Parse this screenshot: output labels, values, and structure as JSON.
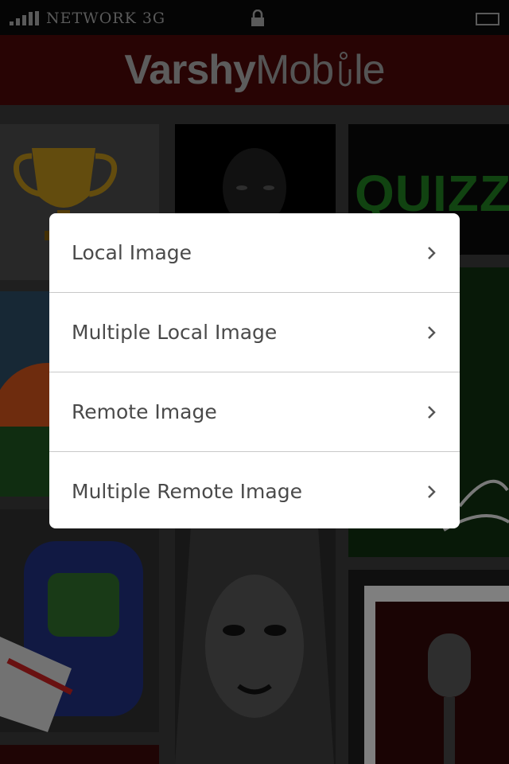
{
  "status_bar": {
    "carrier": "NETWORK 3G",
    "signal_icon": "signal-bars-icon",
    "lock_icon": "lock-icon",
    "battery_icon": "battery-icon"
  },
  "header": {
    "logo_bold": "Varshy",
    "logo_light": "Mob",
    "logo_tail": "le",
    "logo_icon": "hand-pointer-icon",
    "brand_color": "#4a0808"
  },
  "grid": {
    "tile_captions": [
      "QUIZZ"
    ]
  },
  "menu": {
    "items": [
      {
        "label": "Local Image",
        "icon": "chevron-right-icon"
      },
      {
        "label": "Multiple Local Image",
        "icon": "chevron-right-icon"
      },
      {
        "label": "Remote Image",
        "icon": "chevron-right-icon"
      },
      {
        "label": "Multiple Remote Image",
        "icon": "chevron-right-icon"
      }
    ]
  }
}
